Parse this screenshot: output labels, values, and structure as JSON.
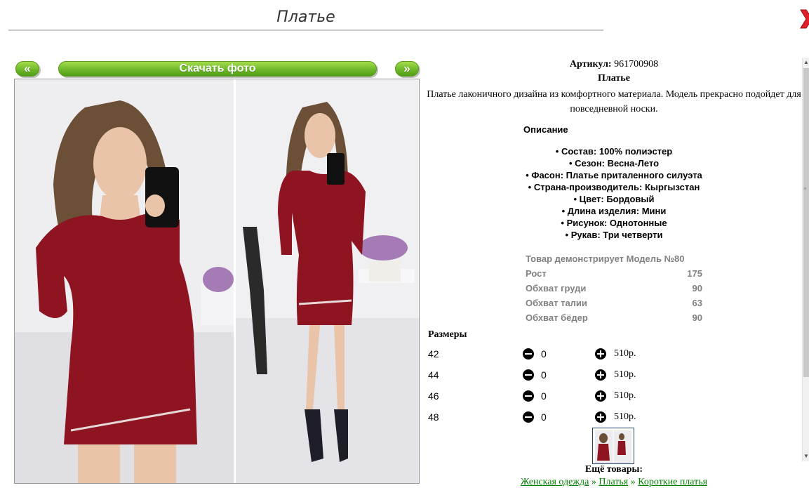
{
  "header": {
    "title": "Платье"
  },
  "colors": {
    "accent_green": "#6fb82a",
    "link_green": "#008000",
    "close_red": "#e0202a",
    "dress": "#8e1422"
  },
  "gallery": {
    "prev_label": "«",
    "next_label": "»",
    "download_label": "Скачать фото"
  },
  "product": {
    "article_label": "Артикул:",
    "article_value": "961700908",
    "name": "Платье",
    "description": "Платье лаконичного дизайна из комфортного материала. Модель прекрасно подойдет для повседневной носки."
  },
  "description_section": {
    "heading": "Описание",
    "items": [
      "Состав: 100% полиэстер",
      "Сезон: Весна-Лето",
      "Фасон: Платье приталенного силуэта",
      "Страна-производитель: Кыргызстан",
      "Цвет: Бордовый",
      "Длина изделия: Мини",
      "Рисунок: Однотонные",
      "Рукав: Три четверти"
    ]
  },
  "model": {
    "heading": "Товар демонстрирует Модель №80",
    "rows": [
      {
        "label": "Рост",
        "value": "175"
      },
      {
        "label": "Обхват груди",
        "value": "90"
      },
      {
        "label": "Обхват талии",
        "value": "63"
      },
      {
        "label": "Обхват бёдер",
        "value": "90"
      }
    ]
  },
  "sizes": {
    "heading": "Размеры",
    "rows": [
      {
        "size": "42",
        "qty": "0",
        "price": "510р."
      },
      {
        "size": "44",
        "qty": "0",
        "price": "510р."
      },
      {
        "size": "46",
        "qty": "0",
        "price": "510р."
      },
      {
        "size": "48",
        "qty": "0",
        "price": "510р."
      }
    ]
  },
  "more": {
    "heading": "Ещё товары:",
    "breadcrumbs": [
      "Женская одежда",
      "Платья",
      "Короткие платья"
    ],
    "separator": "»"
  }
}
